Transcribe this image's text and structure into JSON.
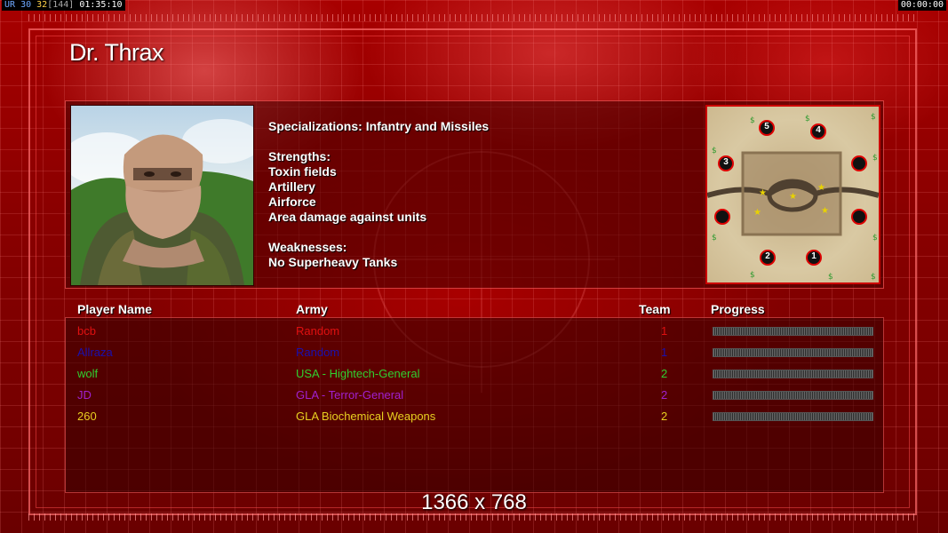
{
  "hud": {
    "ur_label": "UR",
    "fps": "30",
    "fps_limit": "32",
    "fps_max": "[144]",
    "elapsed": "01:35:10",
    "game_time": "00:00:00"
  },
  "general": {
    "name": "Dr. Thrax",
    "specializations": "Specializations: Infantry and Missiles",
    "strengths_label": "Strengths:",
    "strengths": [
      "Toxin fields",
      "Artillery",
      "Airforce",
      "Area damage against units"
    ],
    "weaknesses_label": "Weaknesses:",
    "weaknesses": [
      "No Superheavy Tanks"
    ]
  },
  "map": {
    "start_positions": [
      "1",
      "2",
      "3",
      "4",
      "5"
    ]
  },
  "table": {
    "headers": {
      "name": "Player Name",
      "army": "Army",
      "team": "Team",
      "progress": "Progress"
    },
    "players": [
      {
        "name": "bcb",
        "army": "Random",
        "team": "1",
        "color": "#e01010",
        "progress": 0
      },
      {
        "name": "Allraza",
        "army": "Random",
        "team": "1",
        "color": "#1a10b0",
        "progress": 0
      },
      {
        "name": "wolf",
        "army": "USA - Hightech-General",
        "team": "2",
        "color": "#30d030",
        "progress": 0
      },
      {
        "name": "JD",
        "army": "GLA - Terror-General",
        "team": "2",
        "color": "#a020d0",
        "progress": 0
      },
      {
        "name": "260",
        "army": "GLA Biochemical Weapons",
        "team": "2",
        "color": "#e8d020",
        "progress": 0
      }
    ]
  },
  "resolution": "1366 x 768"
}
